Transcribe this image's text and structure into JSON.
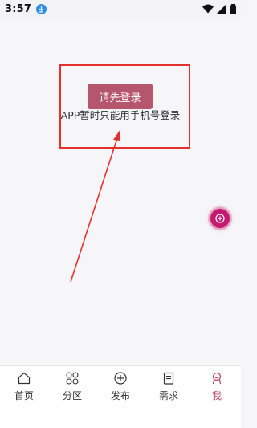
{
  "status_bar": {
    "time": "3:57",
    "app_icon": "download-badge-icon",
    "icons": [
      "wifi-icon",
      "signal-icon",
      "battery-icon"
    ]
  },
  "main": {
    "login_button_label": "请先登录",
    "notice_text": "APP暂时只能用手机号登录",
    "floating_button_icon": "plus-circle-icon"
  },
  "tab_bar": {
    "tabs": [
      {
        "label": "首页",
        "icon": "home-icon",
        "active": false
      },
      {
        "label": "分区",
        "icon": "grid-circles-icon",
        "active": false
      },
      {
        "label": "发布",
        "icon": "plus-circle-icon",
        "active": false
      },
      {
        "label": "需求",
        "icon": "clipboard-icon",
        "active": false
      },
      {
        "label": "我",
        "icon": "user-icon",
        "active": true
      }
    ],
    "active_color": "#b4465c"
  },
  "colors": {
    "background": "#f6f5f8",
    "login_button": "#b5566d",
    "annotation": "#e4312f",
    "floating_button": "#c41a70"
  }
}
